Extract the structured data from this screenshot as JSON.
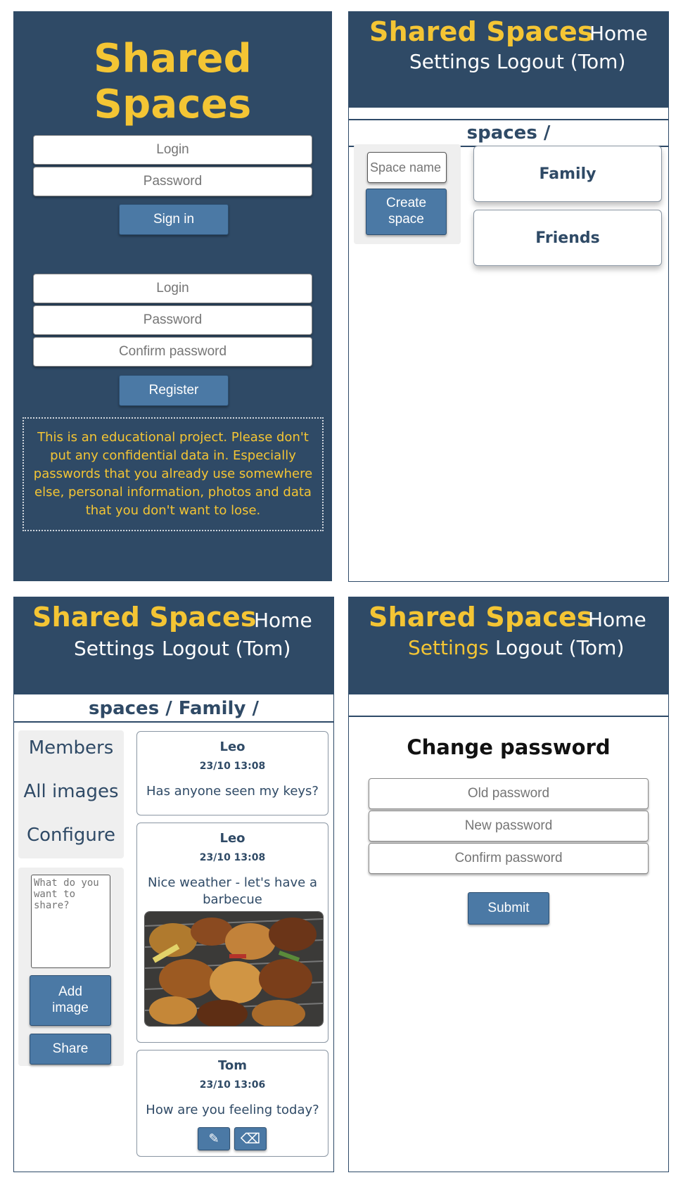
{
  "brand": "Shared Spaces",
  "nav": {
    "home": "Home",
    "settings": "Settings",
    "logout": "Logout (Tom)"
  },
  "login_screen": {
    "signin": {
      "login_placeholder": "Login",
      "password_placeholder": "Password",
      "button": "Sign in"
    },
    "register": {
      "login_placeholder": "Login",
      "password_placeholder": "Password",
      "confirm_placeholder": "Confirm password",
      "button": "Register"
    },
    "notice": "This is an educational project. Please don't put any confidential data in. Especially passwords that you already use somewhere else, personal information, photos and data that you don't want to lose."
  },
  "spaces_screen": {
    "breadcrumb": "spaces /",
    "space_name_placeholder": "Space name",
    "create_button": "Create space",
    "spaces": [
      "Family",
      "Friends"
    ]
  },
  "family_screen": {
    "breadcrumb": "spaces / Family /",
    "sidebar": [
      "Members",
      "All images",
      "Configure"
    ],
    "share_placeholder": "What do you want to share?",
    "add_image_button": "Add image",
    "share_button": "Share",
    "posts": [
      {
        "author": "Leo",
        "time": "23/10 13:08",
        "text": "Has anyone seen my keys?"
      },
      {
        "author": "Leo",
        "time": "23/10 13:08",
        "text": "Nice weather - let's have a barbecue"
      },
      {
        "author": "Tom",
        "time": "23/10 13:06",
        "text": "How are you feeling today?"
      }
    ]
  },
  "settings_screen": {
    "title": "Change password",
    "old_placeholder": "Old password",
    "new_placeholder": "New password",
    "confirm_placeholder": "Confirm password",
    "submit_button": "Submit"
  },
  "colors": {
    "navy": "#2f4a66",
    "accent": "#f4c534",
    "button": "#4b79a5"
  }
}
